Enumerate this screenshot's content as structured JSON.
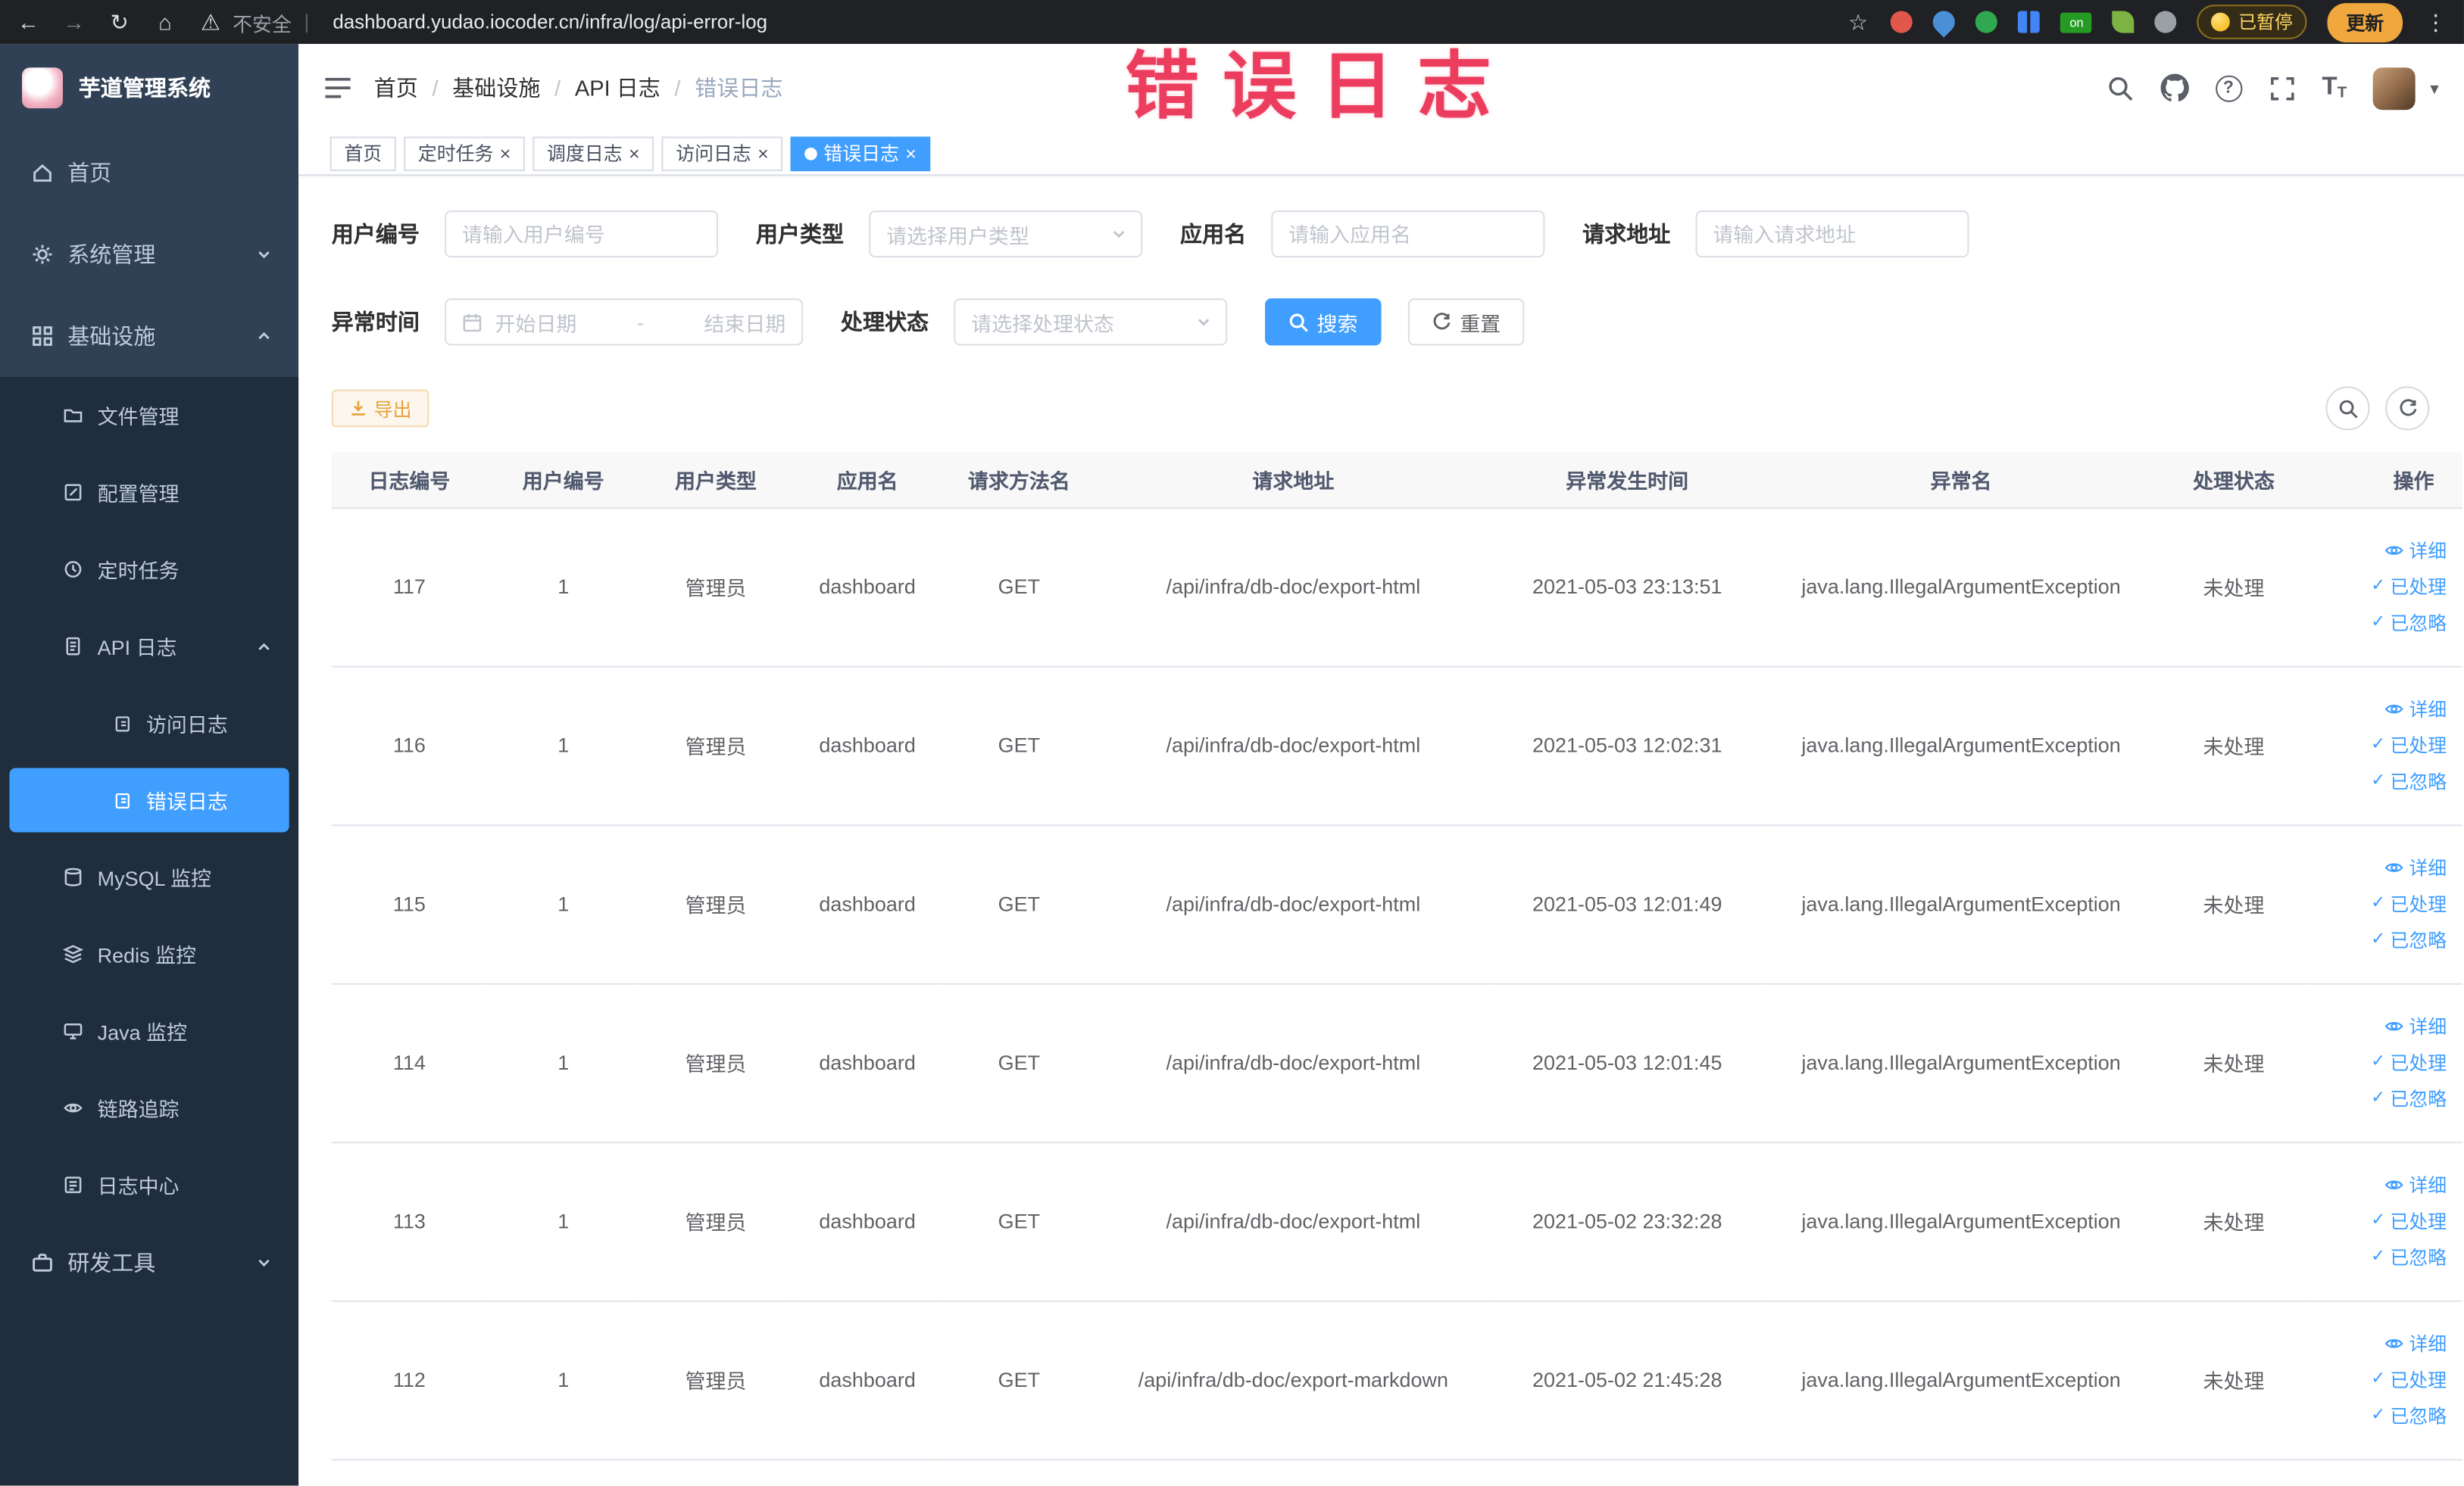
{
  "watermark": "错误日志",
  "icons": {
    "back": "←",
    "forward": "→",
    "reload": "↻",
    "home": "⌂",
    "warning": "⚠",
    "star": "☆",
    "menu_dots": "⋮",
    "close": "×",
    "check": "✓",
    "caret_down": "▾",
    "help": "?",
    "font_size_letter": "T"
  },
  "browser": {
    "warning_label": "不安全",
    "url": "dashboard.yudao.iocoder.cn/infra/log/api-error-log",
    "extension_on_badge": "on",
    "paused_badge": "已暂停",
    "update_button": "更新"
  },
  "sidebar": {
    "logo_title": "芋道管理系统",
    "items": {
      "home": "首页",
      "system": "系统管理",
      "infra": "基础设施",
      "file": "文件管理",
      "config": "配置管理",
      "job": "定时任务",
      "api_log": "API 日志",
      "access_log": "访问日志",
      "error_log": "错误日志",
      "mysql": "MySQL 监控",
      "redis": "Redis 监控",
      "java": "Java 监控",
      "trace": "链路追踪",
      "log_center": "日志中心",
      "dev_tools": "研发工具"
    }
  },
  "breadcrumb": [
    "首页",
    "基础设施",
    "API 日志",
    "错误日志"
  ],
  "tabs": [
    {
      "label": "首页",
      "closable": false,
      "active": false
    },
    {
      "label": "定时任务",
      "closable": true,
      "active": false
    },
    {
      "label": "调度日志",
      "closable": true,
      "active": false
    },
    {
      "label": "访问日志",
      "closable": true,
      "active": false
    },
    {
      "label": "错误日志",
      "closable": true,
      "active": true
    }
  ],
  "filters": {
    "user_id": {
      "label": "用户编号",
      "placeholder": "请输入用户编号"
    },
    "user_type": {
      "label": "用户类型",
      "placeholder": "请选择用户类型"
    },
    "app_name": {
      "label": "应用名",
      "placeholder": "请输入应用名"
    },
    "request_url": {
      "label": "请求地址",
      "placeholder": "请输入请求地址"
    },
    "exception_time": {
      "label": "异常时间",
      "start_placeholder": "开始日期",
      "separator": "-",
      "end_placeholder": "结束日期"
    },
    "process_status": {
      "label": "处理状态",
      "placeholder": "请选择处理状态"
    },
    "search_button": "搜索",
    "reset_button": "重置"
  },
  "toolbar": {
    "export_button": "导出"
  },
  "table": {
    "columns": [
      "日志编号",
      "用户编号",
      "用户类型",
      "应用名",
      "请求方法名",
      "请求地址",
      "异常发生时间",
      "异常名",
      "处理状态",
      "操作"
    ],
    "rows": [
      {
        "id": "117",
        "user_id": "1",
        "user_type": "管理员",
        "app": "dashboard",
        "method": "GET",
        "url": "/api/infra/db-doc/export-html",
        "time": "2021-05-03 23:13:51",
        "exception": "java.lang.IllegalArgumentException",
        "status": "未处理"
      },
      {
        "id": "116",
        "user_id": "1",
        "user_type": "管理员",
        "app": "dashboard",
        "method": "GET",
        "url": "/api/infra/db-doc/export-html",
        "time": "2021-05-03 12:02:31",
        "exception": "java.lang.IllegalArgumentException",
        "status": "未处理"
      },
      {
        "id": "115",
        "user_id": "1",
        "user_type": "管理员",
        "app": "dashboard",
        "method": "GET",
        "url": "/api/infra/db-doc/export-html",
        "time": "2021-05-03 12:01:49",
        "exception": "java.lang.IllegalArgumentException",
        "status": "未处理"
      },
      {
        "id": "114",
        "user_id": "1",
        "user_type": "管理员",
        "app": "dashboard",
        "method": "GET",
        "url": "/api/infra/db-doc/export-html",
        "time": "2021-05-03 12:01:45",
        "exception": "java.lang.IllegalArgumentException",
        "status": "未处理"
      },
      {
        "id": "113",
        "user_id": "1",
        "user_type": "管理员",
        "app": "dashboard",
        "method": "GET",
        "url": "/api/infra/db-doc/export-html",
        "time": "2021-05-02 23:32:28",
        "exception": "java.lang.IllegalArgumentException",
        "status": "未处理"
      },
      {
        "id": "112",
        "user_id": "1",
        "user_type": "管理员",
        "app": "dashboard",
        "method": "GET",
        "url": "/api/infra/db-doc/export-markdown",
        "time": "2021-05-02 21:45:28",
        "exception": "java.lang.IllegalArgumentException",
        "status": "未处理"
      }
    ],
    "row_actions": {
      "detail": "详细",
      "processed": "已处理",
      "ignored": "已忽略"
    }
  },
  "colors": {
    "accent": "#409eff",
    "warning": "#e6a23c",
    "sidebar_bg": "#304156",
    "submenu_bg": "#1f2d3d",
    "watermark": "#ec3d5e",
    "link": "#409eff"
  }
}
